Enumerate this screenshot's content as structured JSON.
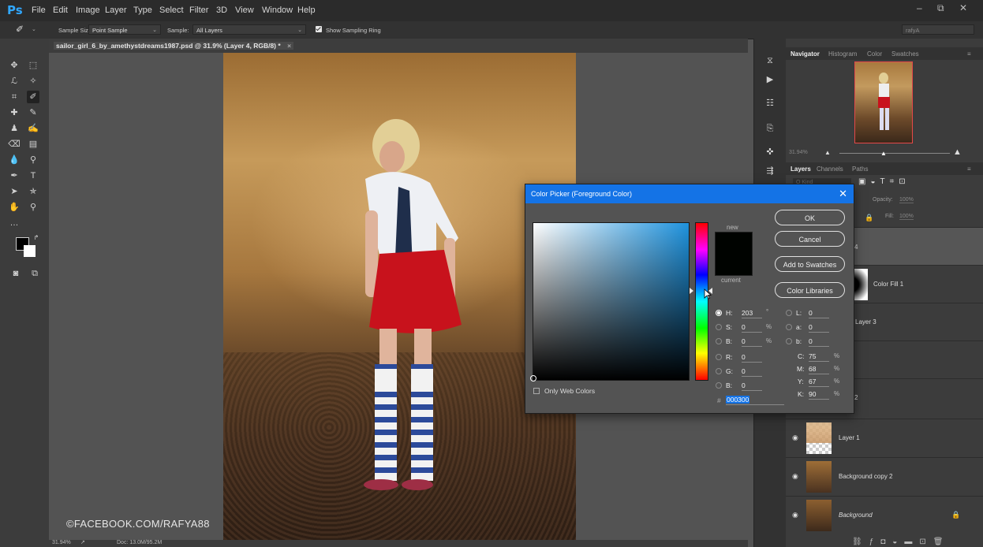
{
  "menubar": {
    "logo": "Ps",
    "items": [
      "File",
      "Edit",
      "Image",
      "Layer",
      "Type",
      "Select",
      "Filter",
      "3D",
      "View",
      "Window",
      "Help"
    ],
    "window_controls": [
      "–",
      "⧉",
      "✕"
    ]
  },
  "options": {
    "sample_size_label": "Sample Size:",
    "sample_size_value": "Point Sample",
    "sample_label": "Sample:",
    "sample_value": "All Layers",
    "show_ring_label": "Show Sampling Ring",
    "workspace": "rafyA"
  },
  "document": {
    "tab_title": "sailor_girl_6_by_amethystdreams1987.psd @ 31.9% (Layer 4, RGB/8) *",
    "close": "×",
    "watermark": "©FACEBOOK.COM/RAFYA88",
    "status_zoom": "31.94%",
    "status_doc": "Doc: 13.0M/95.2M"
  },
  "navigator": {
    "tabs": [
      "Navigator",
      "Histogram",
      "Color",
      "Swatches"
    ],
    "zoom": "31.94%"
  },
  "layers_panel": {
    "tabs": [
      "Layers",
      "Channels",
      "Paths"
    ],
    "search_placeholder": "Q Kind",
    "opacity_label": "Opacity:",
    "opacity_value": "100%",
    "fill_label": "Fill:",
    "fill_value": "100%",
    "partial_labels": [
      "4",
      "2"
    ],
    "layers": [
      {
        "name": "Color Fill 1"
      },
      {
        "name": "Layer 3"
      },
      {
        "name": "Layer 1"
      },
      {
        "name": "Background copy 2"
      },
      {
        "name": "Background"
      }
    ]
  },
  "color_picker": {
    "title": "Color Picker (Foreground Color)",
    "close": "✕",
    "new_label": "new",
    "current_label": "current",
    "swatch_color": "#000300",
    "buttons": [
      "OK",
      "Cancel",
      "Add to Swatches",
      "Color Libraries"
    ],
    "only_web_colors": "Only Web Colors",
    "fields_left": [
      {
        "label": "H:",
        "value": "203",
        "unit": "°",
        "selected": true
      },
      {
        "label": "S:",
        "value": "0",
        "unit": "%",
        "selected": false
      },
      {
        "label": "B:",
        "value": "0",
        "unit": "%",
        "selected": false
      },
      {
        "label": "R:",
        "value": "0",
        "unit": "",
        "selected": false
      },
      {
        "label": "G:",
        "value": "0",
        "unit": "",
        "selected": false
      },
      {
        "label": "B:",
        "value": "0",
        "unit": "",
        "selected": false
      }
    ],
    "fields_lab": [
      {
        "label": "L:",
        "value": "0"
      },
      {
        "label": "a:",
        "value": "0"
      },
      {
        "label": "b:",
        "value": "0"
      }
    ],
    "fields_cmyk": [
      {
        "label": "C:",
        "value": "75",
        "unit": "%"
      },
      {
        "label": "M:",
        "value": "68",
        "unit": "%"
      },
      {
        "label": "Y:",
        "value": "67",
        "unit": "%"
      },
      {
        "label": "K:",
        "value": "90",
        "unit": "%"
      }
    ],
    "hex_label": "#",
    "hex_value": "000300"
  }
}
